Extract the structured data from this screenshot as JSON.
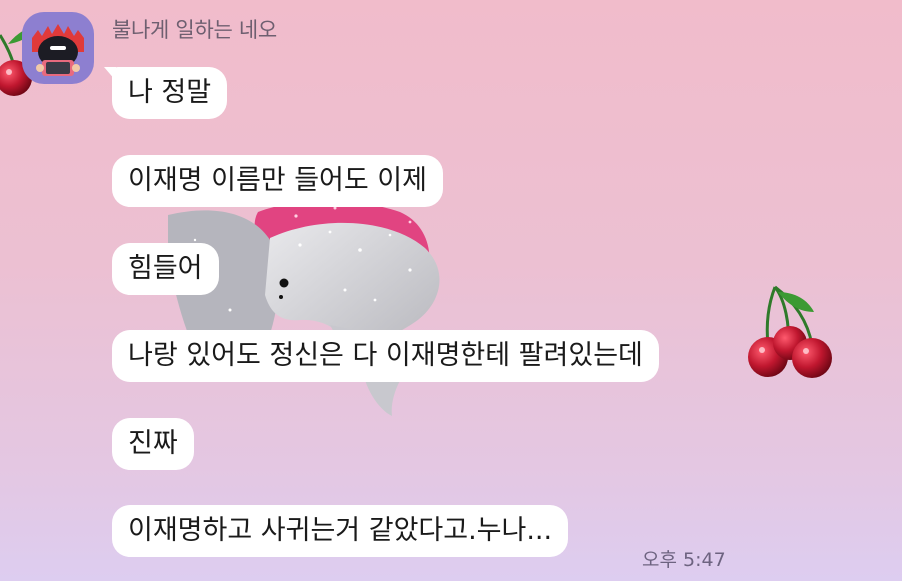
{
  "chat": {
    "sender_name": "불나게 일하는 네오",
    "messages": [
      {
        "text": "나 정말"
      },
      {
        "text": "이재명 이름만 들어도 이제"
      },
      {
        "text": "힘들어"
      },
      {
        "text": "나랑 있어도 정신은 다 이재명한테 팔려있는데"
      },
      {
        "text": "진짜"
      },
      {
        "text": "이재명하고 사귀는거 같았다고.누나..."
      }
    ],
    "timestamp": "오후 5:47"
  },
  "icons": {
    "avatar": "neo-character-avatar",
    "decorations": [
      "cherry-icon",
      "dolphin-icon"
    ]
  },
  "colors": {
    "bubble": "#ffffff",
    "avatar_bg": "#8d7fd0",
    "cherry": "#b3142a"
  }
}
